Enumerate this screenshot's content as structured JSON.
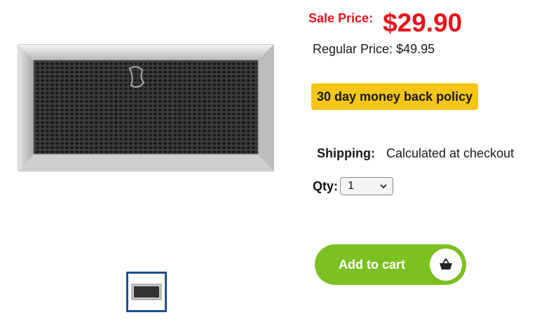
{
  "product": {
    "image_icon": "charcoal-filter-photo",
    "thumbnail_icon": "charcoal-filter-thumbnail"
  },
  "pricing": {
    "sale_label": "Sale Price:",
    "sale_price": "$29.90",
    "regular_label": "Regular Price:",
    "regular_price": "$49.95",
    "sale_color": "#e8141b"
  },
  "policy": {
    "text": "30 day money back policy",
    "color": "#f5c518"
  },
  "shipping": {
    "label": "Shipping:",
    "value": "Calculated at checkout"
  },
  "quantity": {
    "label": "Qty:",
    "selected": "1"
  },
  "cart": {
    "label": "Add to cart",
    "icon": "basket-icon",
    "color": "#7cc021"
  }
}
